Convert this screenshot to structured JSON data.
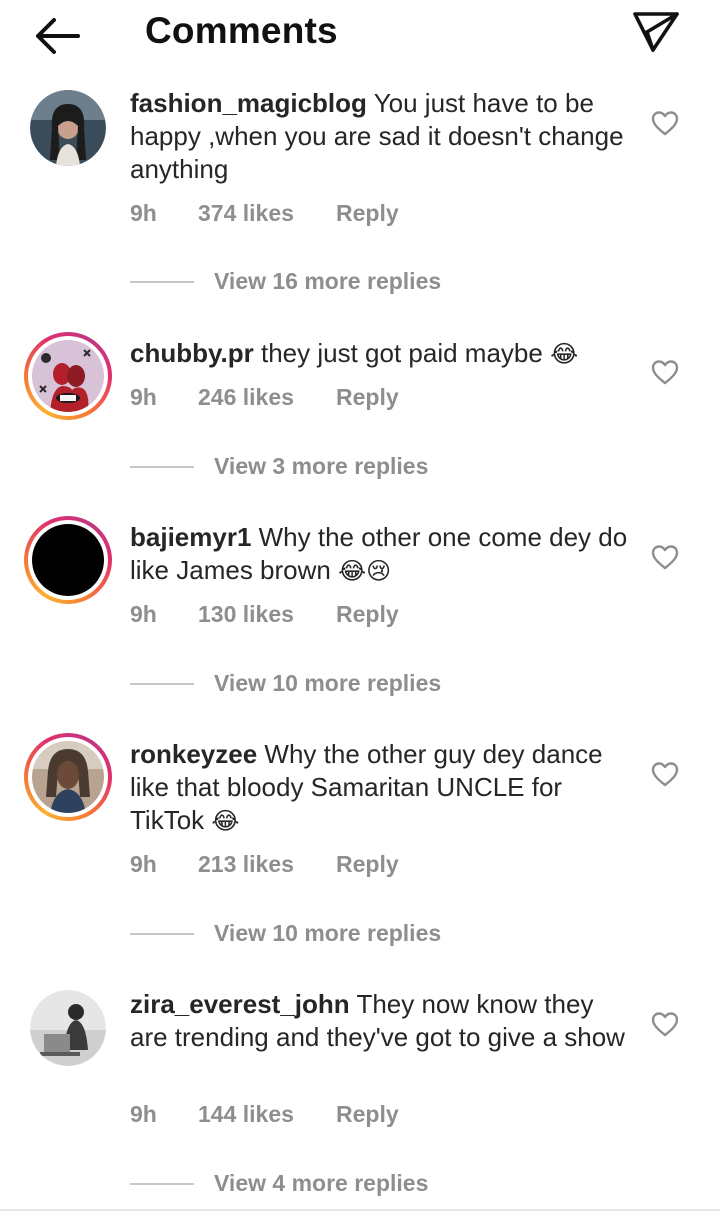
{
  "header": {
    "title": "Comments",
    "back_icon": "arrow-left-icon",
    "send_icon": "send-icon"
  },
  "comments": [
    {
      "username": "fashion_magicblog",
      "text": "You just have to be happy ,when you are sad it doesn't change anything",
      "emoji": "",
      "time": "9h",
      "likes": "374 likes",
      "reply": "Reply",
      "view_replies": "View 16 more replies",
      "has_story_ring": false,
      "avatar_colors": [
        "#3a4c5a",
        "#c9a08c"
      ]
    },
    {
      "username": "chubby.pr",
      "text": "they just got paid maybe",
      "emoji": "😂",
      "time": "9h",
      "likes": "246 likes",
      "reply": "Reply",
      "view_replies": "View 3 more replies",
      "has_story_ring": true,
      "avatar_colors": [
        "#d8c2d8",
        "#b3202a"
      ]
    },
    {
      "username": "bajiemyr1",
      "text": "Why the other one come dey do like James brown",
      "emoji": "😂😢",
      "time": "9h",
      "likes": "130 likes",
      "reply": "Reply",
      "view_replies": "View 10 more replies",
      "has_story_ring": true,
      "avatar_colors": [
        "#000000",
        "#000000"
      ]
    },
    {
      "username": "ronkeyzee",
      "text": "Why the other guy dey dance like that bloody Samaritan UNCLE for TikTok",
      "emoji": "😂",
      "time": "9h",
      "likes": "213 likes",
      "reply": "Reply",
      "view_replies": "View 10 more replies",
      "has_story_ring": true,
      "avatar_colors": [
        "#b7a38f",
        "#4a3a30"
      ]
    },
    {
      "username": "zira_everest_john",
      "text": "They now know they are trending and they've got to give a show",
      "emoji": "",
      "time": "9h",
      "likes": "144 likes",
      "reply": "Reply",
      "view_replies": "View 4 more replies",
      "has_story_ring": false,
      "avatar_colors": [
        "#e6e6e6",
        "#5a5a5a"
      ]
    }
  ]
}
